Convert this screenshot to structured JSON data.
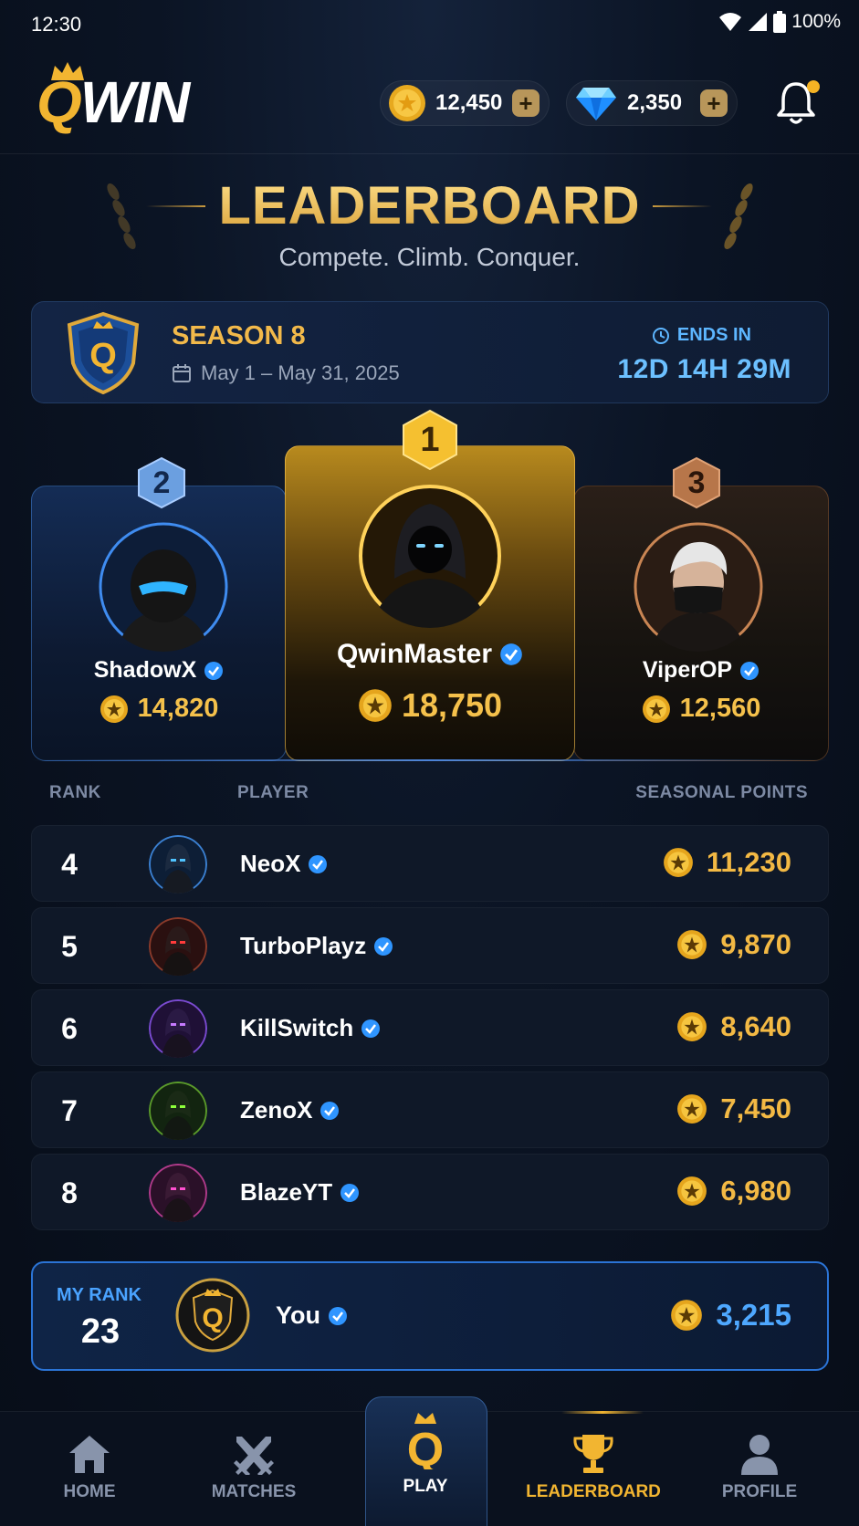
{
  "status_bar": {
    "time": "12:30",
    "battery": "100%"
  },
  "header": {
    "logo_q": "Q",
    "logo_rest": "WIN",
    "coins": "12,450",
    "gems": "2,350",
    "plus": "+"
  },
  "title": {
    "heading": "LEADERBOARD",
    "subtitle": "Compete. Climb. Conquer."
  },
  "season": {
    "name": "SEASON 8",
    "dates": "May 1 – May 31, 2025",
    "ends_label": "ENDS IN",
    "ends_value": "12D 14H 29M"
  },
  "podium": [
    {
      "rank": "2",
      "name": "ShadowX",
      "points": "14,820"
    },
    {
      "rank": "1",
      "name": "QwinMaster",
      "points": "18,750"
    },
    {
      "rank": "3",
      "name": "ViperOP",
      "points": "12,560"
    }
  ],
  "table": {
    "col_rank": "RANK",
    "col_player": "PLAYER",
    "col_points": "SEASONAL POINTS",
    "rows": [
      {
        "rank": "4",
        "name": "NeoX",
        "points": "11,230"
      },
      {
        "rank": "5",
        "name": "TurboPlayz",
        "points": "9,870"
      },
      {
        "rank": "6",
        "name": "KillSwitch",
        "points": "8,640"
      },
      {
        "rank": "7",
        "name": "ZenoX",
        "points": "7,450"
      },
      {
        "rank": "8",
        "name": "BlazeYT",
        "points": "6,980"
      }
    ]
  },
  "my_rank": {
    "label": "MY RANK",
    "rank": "23",
    "name": "You",
    "points": "3,215"
  },
  "nav": {
    "home": "HOME",
    "matches": "MATCHES",
    "play": "PLAY",
    "leaderboard": "LEADERBOARD",
    "profile": "PROFILE"
  },
  "colors": {
    "gold": "#f2b531",
    "blue_accent": "#4aa3ff",
    "background": "#0b1424"
  },
  "icons": [
    "wifi-icon",
    "signal-icon",
    "battery-icon",
    "crown-icon",
    "coin-icon",
    "gem-icon",
    "plus-icon",
    "bell-icon",
    "calendar-icon",
    "clock-icon",
    "verified-icon",
    "star-coin-icon",
    "home-icon",
    "swords-icon",
    "q-logo-icon",
    "trophy-icon",
    "user-icon"
  ]
}
